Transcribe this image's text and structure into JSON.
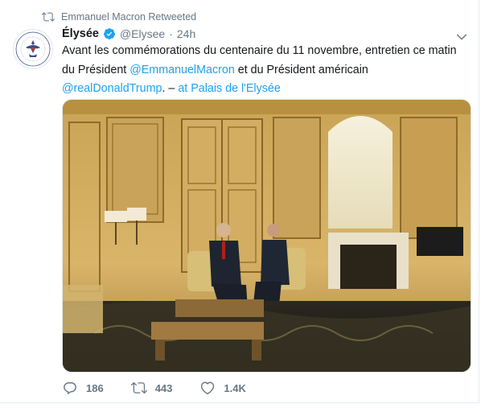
{
  "retweet_context": {
    "icon": "retweet-icon",
    "text": "Emmanuel Macron Retweeted"
  },
  "tweet": {
    "author_name": "Élysée",
    "verified_icon": "verified-badge-icon",
    "handle": "@Elysee",
    "separator": "·",
    "time": "24h",
    "text_parts": {
      "p1": "Avant les commémorations du centenaire du 11 novembre, entretien ce matin du Président ",
      "mention1": "@EmmanuelMacron",
      "p2": " et du Président américain ",
      "mention2": "@realDonaldTrump",
      "p3": ". – ",
      "location": "at Palais de l'Elysée"
    },
    "media": {
      "kind": "photo",
      "icon": "photo-icon"
    }
  },
  "actions": {
    "reply": {
      "icon": "reply-icon",
      "count": "186"
    },
    "retweet": {
      "icon": "retweet-icon",
      "count": "443"
    },
    "like": {
      "icon": "heart-icon",
      "count": "1.4K"
    }
  },
  "colors": {
    "link": "#1da1f2",
    "muted": "#657786",
    "verified": "#1da1f2"
  }
}
